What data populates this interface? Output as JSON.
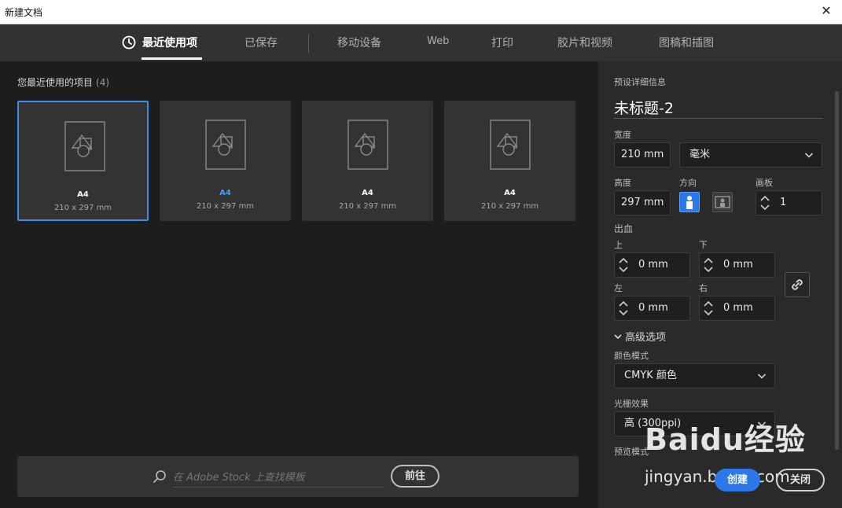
{
  "window": {
    "title": "新建文档",
    "close_glyph": "✕"
  },
  "tabs": [
    {
      "label": "最近使用项",
      "active": true
    },
    {
      "label": "已保存"
    },
    {
      "label": "移动设备"
    },
    {
      "label": "Web"
    },
    {
      "label": "打印"
    },
    {
      "label": "胶片和视频"
    },
    {
      "label": "图稿和插图"
    }
  ],
  "recent": {
    "title": "您最近使用的项目",
    "count": "(4)",
    "items": [
      {
        "name": "A4",
        "size": "210 x 297 mm",
        "selected": true
      },
      {
        "name": "A4",
        "size": "210 x 297 mm"
      },
      {
        "name": "A4",
        "size": "210 x 297 mm"
      },
      {
        "name": "A4",
        "size": "210 x 297 mm"
      }
    ]
  },
  "stock": {
    "placeholder": "在 Adobe Stock 上查找模板",
    "go_label": "前往"
  },
  "preset": {
    "section_title": "预设详细信息",
    "doc_name": "未标题-2",
    "width_label": "宽度",
    "width_value": "210 mm",
    "unit_value": "毫米",
    "height_label": "高度",
    "height_value": "297 mm",
    "orientation_label": "方向",
    "artboards_label": "画板",
    "artboards_value": "1",
    "bleed_label": "出血",
    "bleed_top_label": "上",
    "bleed_top_value": "0 mm",
    "bleed_bottom_label": "下",
    "bleed_bottom_value": "0 mm",
    "bleed_left_label": "左",
    "bleed_left_value": "0 mm",
    "bleed_right_label": "右",
    "bleed_right_value": "0 mm",
    "advanced_label": "高级选项",
    "color_mode_label": "颜色模式",
    "color_mode_value": "CMYK 颜色",
    "raster_label": "光栅效果",
    "raster_value": "高 (300ppi)",
    "preview_label": "预览模式"
  },
  "actions": {
    "create_label": "创建",
    "close_label": "关闭"
  },
  "watermark": {
    "brand": "Baidu经验",
    "url": "jingyan.baidu.com"
  },
  "colors": {
    "accent": "#2c78e8",
    "selected_border": "#378ef0",
    "background": "#1d1d1d",
    "panel": "#2a2a2a"
  }
}
